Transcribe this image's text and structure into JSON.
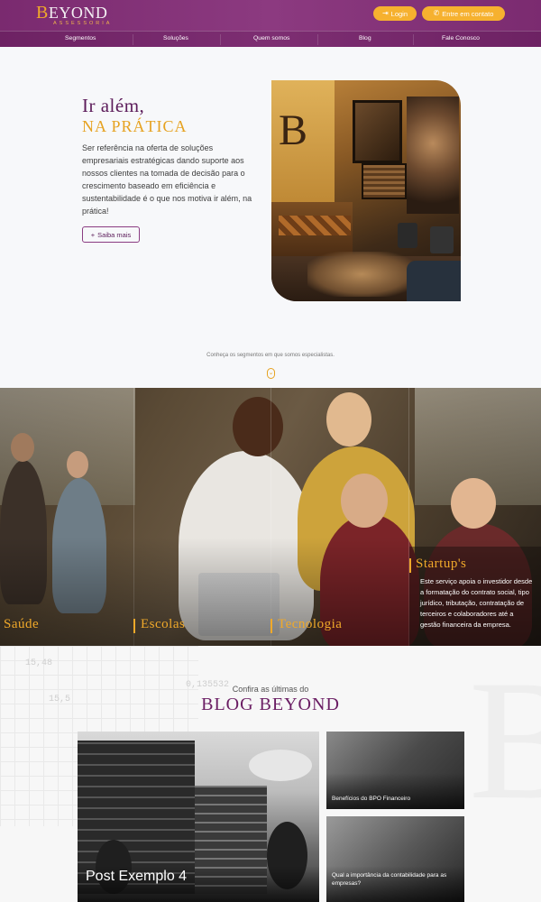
{
  "header": {
    "logo_text": "BEYOND",
    "logo_sub": "ASSESSORIA",
    "login_label": "Login",
    "contact_label": "Entre em contato"
  },
  "nav": {
    "items": [
      {
        "label": "Segmentos"
      },
      {
        "label": "Soluções"
      },
      {
        "label": "Quem somos"
      },
      {
        "label": "Blog"
      },
      {
        "label": "Fale Conosco"
      }
    ]
  },
  "hero": {
    "title_line1": "Ir além,",
    "title_line2": "NA PRÁTICA",
    "text": "Ser referência na oferta de soluções empresariais estratégicas dando suporte aos nossos clientes na tomada de decisão para o crescimento baseado em eficiência e sustentabilidade é o que nos motiva ir além, na prática!",
    "button_label": "Saiba mais"
  },
  "segments": {
    "intro": "Conheça os segmentos em que somos especialistas.",
    "items": [
      {
        "label": "Saúde"
      },
      {
        "label": "Escolas"
      },
      {
        "label": "Tecnologia"
      },
      {
        "label": "Startup's",
        "text": "Este serviço apoia o investidor desde a formatação do contrato social, tipo jurídico, tributação, contratação de terceiros e colaboradores até a gestão financeira da empresa."
      }
    ]
  },
  "blog": {
    "eyebrow": "Confira as últimas do",
    "title": "BLOG BEYOND",
    "bg_numbers": [
      "15,48",
      "15,5",
      "0,135532"
    ],
    "posts": [
      {
        "title": "Post Exemplo 4"
      },
      {
        "title": "Benefícios do BPO Financeiro"
      },
      {
        "title": "Qual a importância da contabilidade para as empresas?"
      }
    ]
  },
  "colors": {
    "brand_purple": "#7a2a6f",
    "accent_gold": "#f0a92a",
    "title_purple": "#5c1c5a"
  }
}
